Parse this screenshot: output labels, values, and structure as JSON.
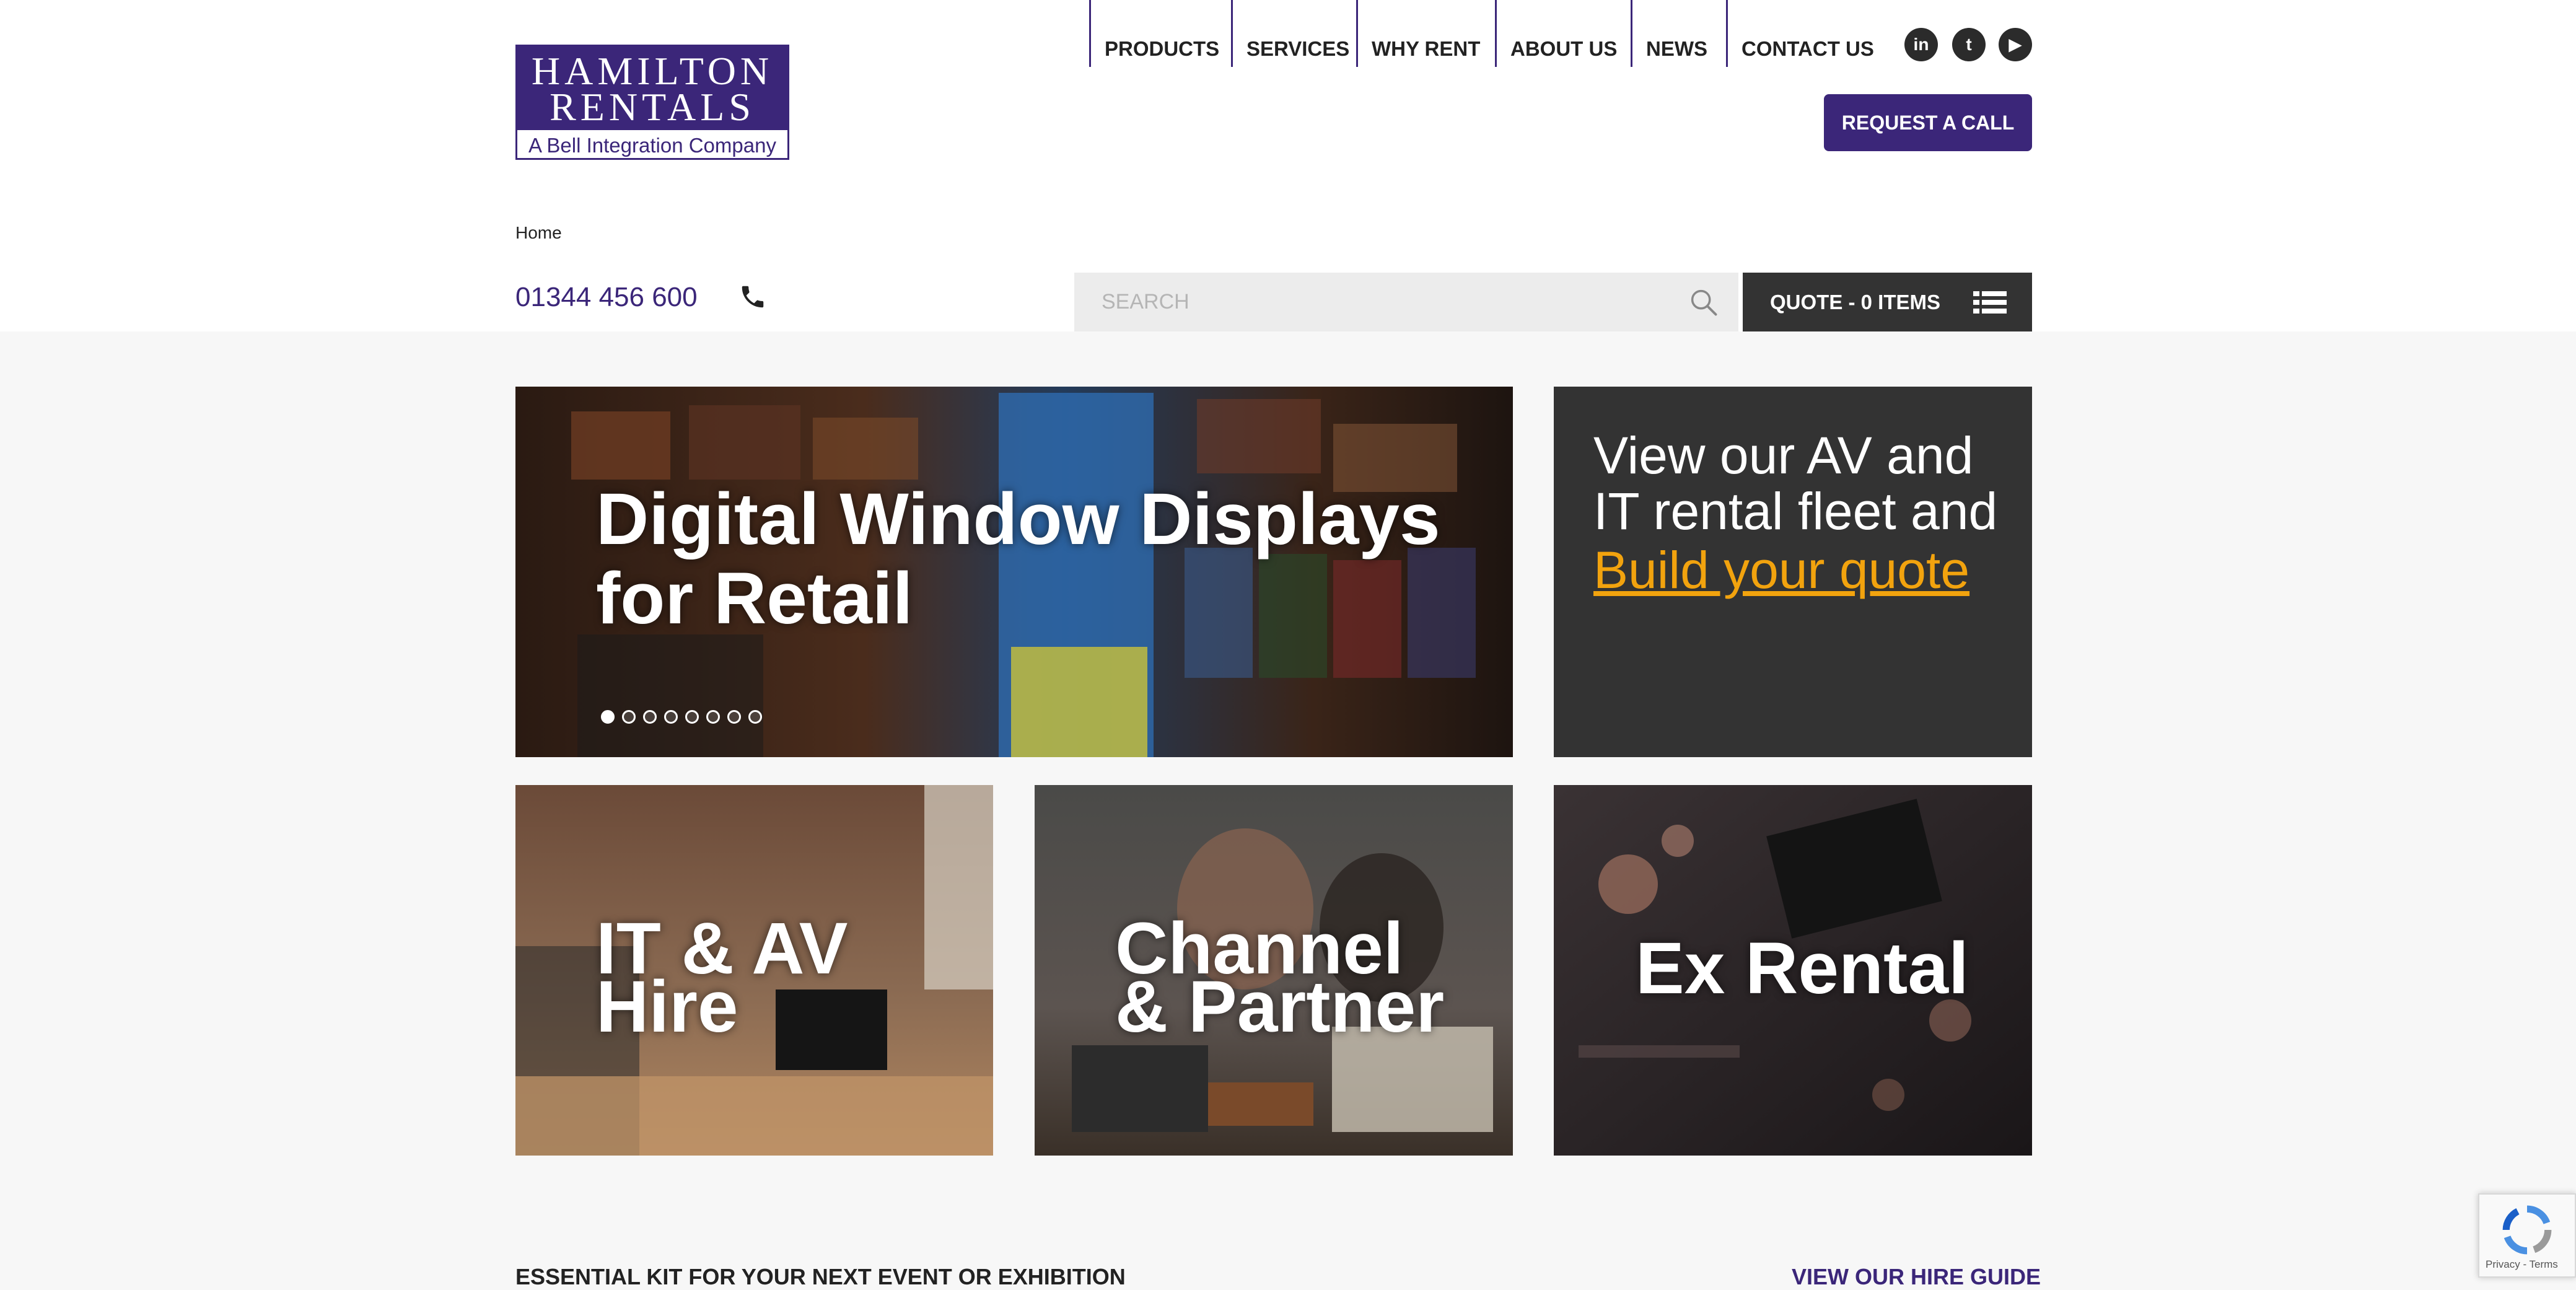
{
  "logo": {
    "line1": "HAMILTON",
    "line2": "RENTALS",
    "subline": "A Bell Integration Company"
  },
  "nav": {
    "items": [
      {
        "label": "PRODUCTS"
      },
      {
        "label": "SERVICES"
      },
      {
        "label": "WHY RENT"
      },
      {
        "label": "ABOUT US"
      },
      {
        "label": "NEWS"
      },
      {
        "label": "CONTACT US"
      }
    ]
  },
  "social": {
    "icons": [
      "linkedin-icon",
      "twitter-icon",
      "youtube-icon"
    ],
    "glyphs": [
      "in",
      "t",
      "▶"
    ]
  },
  "request_call": {
    "label": "REQUEST A CALL"
  },
  "breadcrumb": {
    "home": "Home"
  },
  "contact": {
    "phone": "01344 456 600"
  },
  "search": {
    "placeholder": "SEARCH"
  },
  "quote": {
    "label": "QUOTE - 0 ITEMS"
  },
  "hero": {
    "title_line1": "Digital Window Displays",
    "title_line2": "for Retail",
    "slide_count": 8,
    "active_slide": 1
  },
  "promo": {
    "text": "View our AV and IT rental fleet and",
    "link": "Build your quote"
  },
  "tiles": [
    {
      "line1": "IT & AV",
      "line2": "Hire"
    },
    {
      "line1": "Channel",
      "line2": "& Partner"
    },
    {
      "line1": "Ex Rental",
      "line2": ""
    }
  ],
  "footer_strip": {
    "left": "ESSENTIAL KIT FOR YOUR NEXT EVENT OR EXHIBITION",
    "right": "VIEW OUR HIRE GUIDE"
  },
  "recaptcha": {
    "text": "Privacy - Terms"
  },
  "colors": {
    "brand": "#3b2679",
    "accent": "#f2a30e",
    "dark": "#333333",
    "page_bg": "#f7f7f7"
  }
}
